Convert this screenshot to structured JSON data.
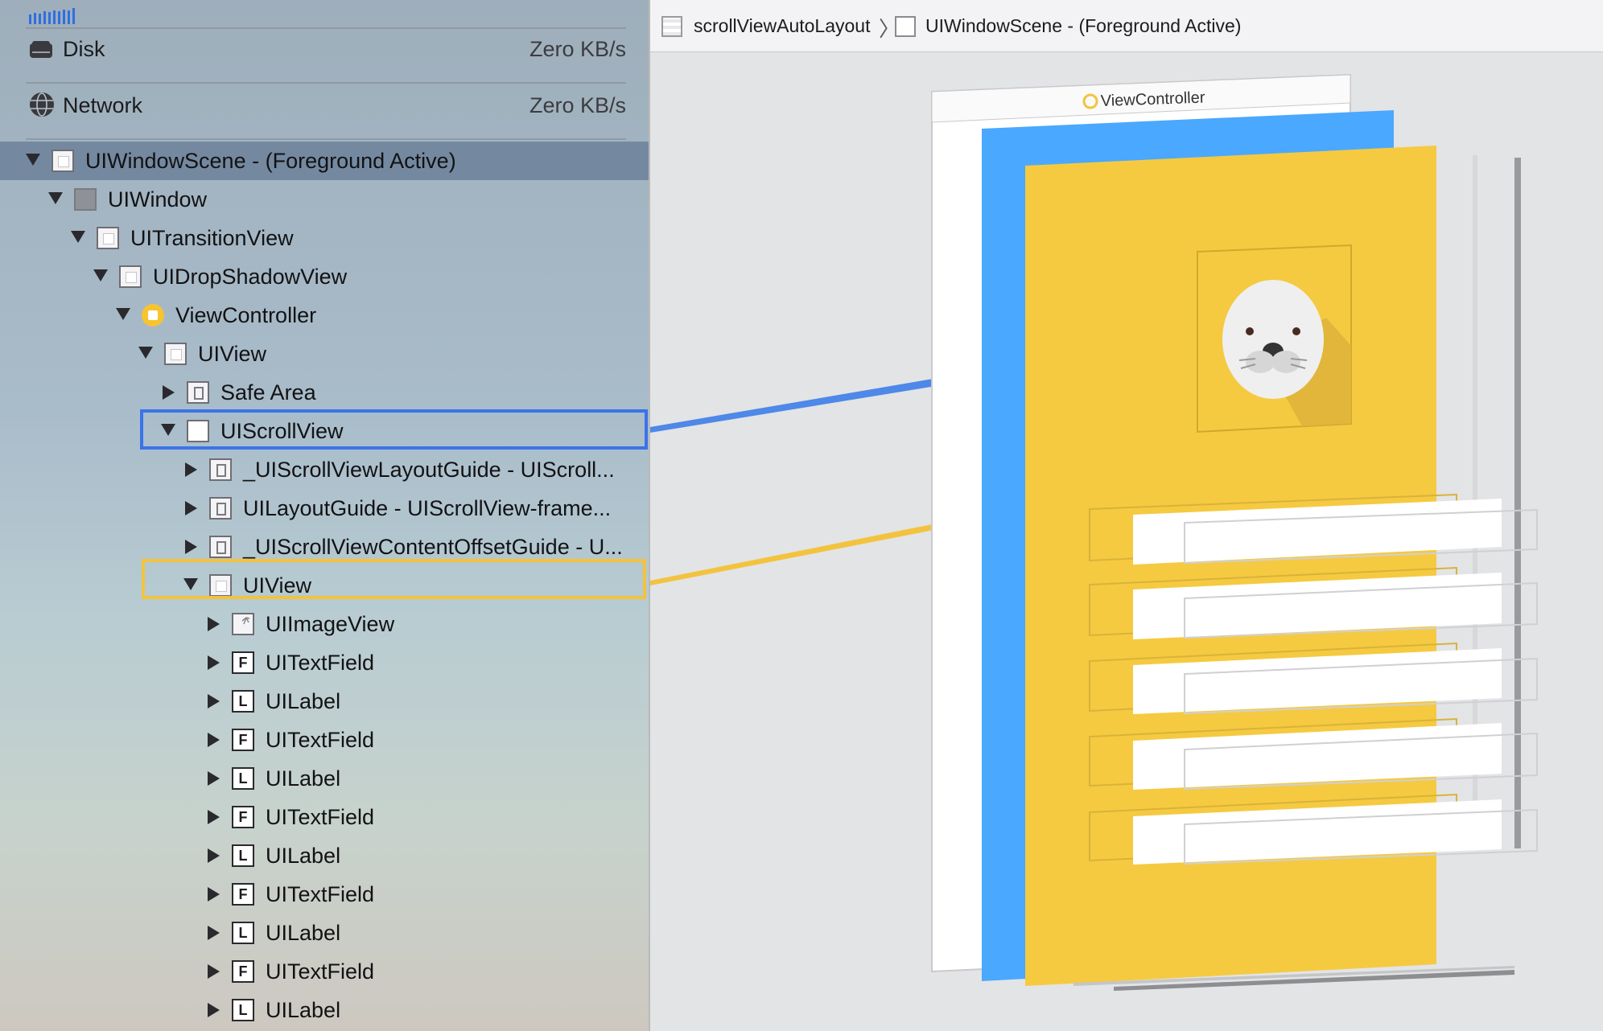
{
  "gauges": [
    {
      "name": "Disk",
      "value": "Zero KB/s",
      "icon": "disk-icon"
    },
    {
      "name": "Network",
      "value": "Zero KB/s",
      "icon": "network-globe-icon"
    }
  ],
  "tree": [
    {
      "label": "UIWindowScene - (Foreground Active)",
      "icon": "view",
      "depth": 0,
      "expanded": true,
      "selected": true
    },
    {
      "label": "UIWindow",
      "icon": "window",
      "depth": 1,
      "expanded": true
    },
    {
      "label": "UITransitionView",
      "icon": "view",
      "depth": 2,
      "expanded": true
    },
    {
      "label": "UIDropShadowView",
      "icon": "view",
      "depth": 3,
      "expanded": true
    },
    {
      "label": "ViewController",
      "icon": "vc",
      "depth": 4,
      "expanded": true
    },
    {
      "label": "UIView",
      "icon": "view",
      "depth": 5,
      "expanded": true
    },
    {
      "label": "Safe Area",
      "icon": "guide",
      "depth": 6,
      "expanded": false
    },
    {
      "label": "UIScrollView",
      "icon": "scroll",
      "depth": 6,
      "expanded": true,
      "highlight": "blue"
    },
    {
      "label": "_UIScrollViewLayoutGuide - UIScroll...",
      "icon": "guide",
      "depth": 7,
      "expanded": false
    },
    {
      "label": "UILayoutGuide - UIScrollView-frame...",
      "icon": "guide",
      "depth": 7,
      "expanded": false
    },
    {
      "label": "_UIScrollViewContentOffsetGuide - U...",
      "icon": "guide",
      "depth": 7,
      "expanded": false
    },
    {
      "label": "UIView",
      "icon": "view",
      "depth": 7,
      "expanded": true,
      "highlight": "yellow"
    },
    {
      "label": "UIImageView",
      "icon": "image",
      "depth": 8,
      "expanded": false
    },
    {
      "label": "UITextField",
      "icon": "letter",
      "letter": "F",
      "depth": 8,
      "expanded": false
    },
    {
      "label": "UILabel",
      "icon": "letter",
      "letter": "L",
      "depth": 8,
      "expanded": false
    },
    {
      "label": "UITextField",
      "icon": "letter",
      "letter": "F",
      "depth": 8,
      "expanded": false
    },
    {
      "label": "UILabel",
      "icon": "letter",
      "letter": "L",
      "depth": 8,
      "expanded": false
    },
    {
      "label": "UITextField",
      "icon": "letter",
      "letter": "F",
      "depth": 8,
      "expanded": false
    },
    {
      "label": "UILabel",
      "icon": "letter",
      "letter": "L",
      "depth": 8,
      "expanded": false
    },
    {
      "label": "UITextField",
      "icon": "letter",
      "letter": "F",
      "depth": 8,
      "expanded": false
    },
    {
      "label": "UILabel",
      "icon": "letter",
      "letter": "L",
      "depth": 8,
      "expanded": false
    },
    {
      "label": "UITextField",
      "icon": "letter",
      "letter": "F",
      "depth": 8,
      "expanded": false
    },
    {
      "label": "UILabel",
      "icon": "letter",
      "letter": "L",
      "depth": 8,
      "expanded": false
    }
  ],
  "jumpbar": {
    "project": "scrollViewAutoLayout",
    "scene": "UIWindowScene - (Foreground Active)"
  },
  "canvas": {
    "vc_title": "ViewController"
  },
  "colors": {
    "scroll_blue": "#4aa8ff",
    "content_yellow": "#f5ca41",
    "highlight_blue": "#3b73e8",
    "highlight_yellow": "#f3c33f",
    "selection": "#7489a0"
  }
}
